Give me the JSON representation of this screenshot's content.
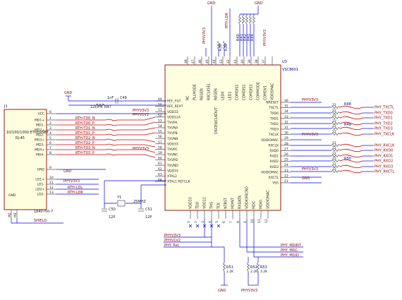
{
  "u3": {
    "ref": "U3",
    "part": "VSC8601",
    "top_labels": [
      "RC",
      "PLLMODE",
      "REGEN",
      "RXCLKSEL",
      "REGEN",
      "LED0",
      "LED1",
      "COMDIS1",
      "COMDIS2",
      "COMDIS3",
      "COMMODE",
      "COMDV1",
      "VDDSMAC"
    ],
    "top_pins": [
      "48",
      "47",
      "46",
      "45",
      "44",
      "43",
      "42",
      "41",
      "40",
      "39",
      "38",
      "37"
    ],
    "left_pins": [
      {
        "num": "49",
        "name": "REF_FILT"
      },
      {
        "num": "50",
        "name": "REF_REXT"
      },
      {
        "num": "51",
        "name": "VDD33"
      },
      {
        "num": "52",
        "name": "VDD12A"
      },
      {
        "num": "53",
        "name": "TXVPA"
      },
      {
        "num": "54",
        "name": "TXVNA"
      },
      {
        "num": "55",
        "name": "TXVPB"
      },
      {
        "num": "56",
        "name": "TXVNB"
      },
      {
        "num": "57",
        "name": "VDD33"
      },
      {
        "num": "58",
        "name": "TXVPC"
      },
      {
        "num": "59",
        "name": "TXVNC"
      },
      {
        "num": "60",
        "name": "TXVPD"
      },
      {
        "num": "61",
        "name": "TXVND"
      },
      {
        "num": "62",
        "name": "VDD33"
      },
      {
        "num": "63",
        "name": "XTAL2"
      },
      {
        "num": "64",
        "name": "XTAL1 REFCLK"
      }
    ],
    "right_pins": [
      {
        "num": "36",
        "name": "NRESET"
      },
      {
        "num": "35",
        "name": "TXCTL"
      },
      {
        "num": "34",
        "name": "TXD0"
      },
      {
        "num": "33",
        "name": "TXD1"
      },
      {
        "num": "32",
        "name": "TXD2"
      },
      {
        "num": "31",
        "name": "TXD3"
      },
      {
        "num": "30",
        "name": "TXCLK"
      },
      {
        "num": "29",
        "name": "VDDIOMAC"
      },
      {
        "num": "28",
        "name": "RXCLK"
      },
      {
        "num": "27",
        "name": "RXD0"
      },
      {
        "num": "26",
        "name": "RXD1"
      },
      {
        "num": "25",
        "name": "RXD2"
      },
      {
        "num": "24",
        "name": "RXD3"
      },
      {
        "num": "23",
        "name": "VDDIOMAC"
      },
      {
        "num": "22",
        "name": "RXCTL"
      },
      {
        "num": "21",
        "name": "VSS"
      }
    ],
    "bottom_labels": [
      "VDD33",
      "TDO",
      "VDD12",
      "TMS",
      "TCK",
      "NTRST",
      "MDINT",
      "RXDATA",
      "VDDIOMICRO",
      "MDC",
      "MDIO",
      "VDDIOMAC"
    ],
    "center_label": "OSCEN/CLKOUT",
    "bottom_pins": [
      "1",
      "2",
      "3",
      "4",
      "5",
      "6",
      "7",
      "8",
      "9",
      "10",
      "11",
      "12",
      "13",
      "14",
      "15",
      "16"
    ]
  },
  "j1": {
    "ref": "J1",
    "name": "10/100/1000 ETHERNET",
    "sub": "RJ-45",
    "part": "1840750-7",
    "pins": [
      "VCC",
      "MD1+",
      "MD1-",
      "MD2+",
      "MD2-",
      "MD3+",
      "MD3-",
      "MD4+",
      "MD4-",
      "GND",
      "LD1+",
      "LD1-",
      "LD2+",
      "LD2-"
    ],
    "pin_nums": [
      "6",
      "1",
      "2",
      "3",
      "4",
      "5",
      "6",
      "7",
      "8",
      "9",
      "10",
      "11",
      "12",
      "13"
    ],
    "shield_label": "SHIELD",
    "gnd_label": "GND",
    "m_labels": [
      "M1",
      "M2"
    ]
  },
  "nets": {
    "rth_left": [
      "RTH-TD0_N",
      "RTH-TD0_P",
      "RTH-TD1_N",
      "RTH-TD1_P",
      "RTH-TD2_N",
      "RTH-TD2_P",
      "RTH-TD3_N",
      "RTH-TD3_P"
    ],
    "right_nets": [
      "PHY_TXCTL",
      "PHY_TXD0",
      "PHY_TXD1",
      "PHY_TXD2",
      "PHY_TXD3",
      "PHY_TXCLK",
      "PHY_RXCLK",
      "PHY_RXD0",
      "PHY_RXD1",
      "PHY_RXD2",
      "PHY_RXD3",
      "PHY_RXCTL"
    ],
    "led_nets": [
      "RTH-LDL",
      "RTH-LDR"
    ],
    "bottom_nets": [
      "PHY_MDINT",
      "PHY_MDC",
      "PHY_MDIO"
    ],
    "bottom_left_nets": [
      "PHYV3V3",
      "PHYV1V2",
      "PHY_Rst"
    ],
    "top_net": "RTH-LDR"
  },
  "power": {
    "gnd": "GND",
    "v33": "PHYV3V3",
    "v12": "PHYV1V2",
    "v33b": "PHYV3V3"
  },
  "components": {
    "c_ref": "1nF",
    "c_ref_name": "C49",
    "r_ext": "R47",
    "r_ext_val": "12k1%",
    "y1": "Y1",
    "y1_freq": "25MHZ",
    "c50": "C50",
    "c51": "C51",
    "c50_val": "12P",
    "c51_val": "12P",
    "r_right": [
      "R48",
      "R49",
      "R50"
    ],
    "r_val": "22",
    "r_top": [
      "R40",
      "R41",
      "R42",
      "R43",
      "R44"
    ],
    "r_top_val": "4K7",
    "r_top_left": [
      "R38",
      "R39"
    ],
    "r_bottom": [
      "R51",
      "R52",
      "R53"
    ],
    "r_bottom_val": "2.2K"
  }
}
